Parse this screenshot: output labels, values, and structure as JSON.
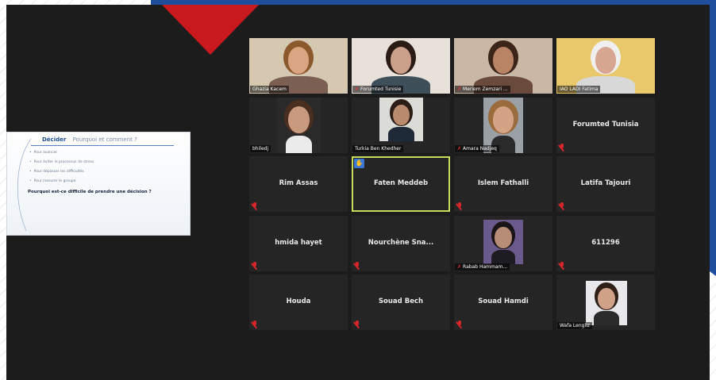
{
  "slide": {
    "heading_word": "Décider",
    "heading_sub": "Pourquoi et comment ?",
    "bullets": [
      "Pour avancer",
      "Pour éviter le processus de stress",
      "Pour dépasser les difficultés",
      "Pour rassurer le groupe"
    ],
    "question": "Pourquoi est-ce difficile de prendre une décision ?"
  },
  "participants": [
    {
      "name": "Ghazia Kacem",
      "video": true,
      "muted": false,
      "palette": {
        "wall": "#d6c7b0",
        "hair": "#8a5a2e",
        "face": "#d9a582",
        "shirt": "#7a5f52"
      }
    },
    {
      "name": "Forumted Tunisie",
      "video": true,
      "muted": true,
      "palette": {
        "wall": "#e7e1da",
        "hair": "#2a1c15",
        "face": "#caa08a",
        "shirt": "#3f4f5a"
      }
    },
    {
      "name": "Meriem Zemzari ...",
      "video": true,
      "muted": true,
      "palette": {
        "wall": "#c9b8a6",
        "hair": "#3b241a",
        "face": "#b98465",
        "shirt": "#6a4a3c"
      }
    },
    {
      "name": "IAO LADI Fatima",
      "video": true,
      "muted": false,
      "palette": {
        "wall": "#e9c86b",
        "hair": "#efefef",
        "face": "#d6a690",
        "shirt": "#d8d8d8"
      }
    },
    {
      "name": "bhiledj",
      "video": true,
      "muted": false,
      "palette": {
        "wall": "#2a2a2a",
        "hair": "#4a2f20",
        "face": "#c99a80",
        "shirt": "#ebebeb"
      }
    },
    {
      "name": "Turkia Ben Khedher",
      "video": true,
      "muted": false,
      "palette": {
        "wall": "#dbdbd8",
        "hair": "#2b1d16",
        "face": "#b88b6e",
        "shirt": "#1f2a38"
      }
    },
    {
      "name": "Amara Nadjeq",
      "video": true,
      "muted": true,
      "palette": {
        "wall": "#9aa0a6",
        "hair": "#9a6b3d",
        "face": "#d4a386",
        "shirt": "#2a2a2a"
      }
    },
    {
      "name": "Forumted Tunisia",
      "video": false,
      "muted": true
    },
    {
      "name": "Rim Assas",
      "video": false,
      "muted": true
    },
    {
      "name": "Faten Meddeb",
      "video": false,
      "muted": false,
      "active": true,
      "hand": true
    },
    {
      "name": "Islem Fathalli",
      "video": false,
      "muted": true
    },
    {
      "name": "Latifa Tajouri",
      "video": false,
      "muted": true
    },
    {
      "name": "hmida hayet",
      "video": false,
      "muted": true
    },
    {
      "name": "Nourchène Sna...",
      "video": false,
      "muted": true
    },
    {
      "name": "Rabab Hammam...",
      "video": true,
      "muted": true,
      "palette": {
        "wall": "#6a5a8c",
        "hair": "#1a1416",
        "face": "#b88d78",
        "shirt": "#1c1c22"
      }
    },
    {
      "name": "611296",
      "video": false,
      "muted": true
    },
    {
      "name": "Houda",
      "video": false,
      "muted": true
    },
    {
      "name": "Souad Bech",
      "video": false,
      "muted": true
    },
    {
      "name": "Souad Hamdi",
      "video": false,
      "muted": true
    },
    {
      "name": "Wafa Lengliz",
      "video": true,
      "muted": false,
      "palette": {
        "wall": "#e8e8ea",
        "hair": "#2e2019",
        "face": "#cfa287",
        "shirt": "#2b2b2b"
      }
    }
  ],
  "icons": {
    "muted": "microphone-muted-icon",
    "hand": "raised-hand-icon"
  },
  "colors": {
    "accent_blue": "#1f4e9c",
    "accent_red": "#c8191f",
    "active_speaker": "#c9dc59",
    "mute_red": "#d8262b"
  }
}
